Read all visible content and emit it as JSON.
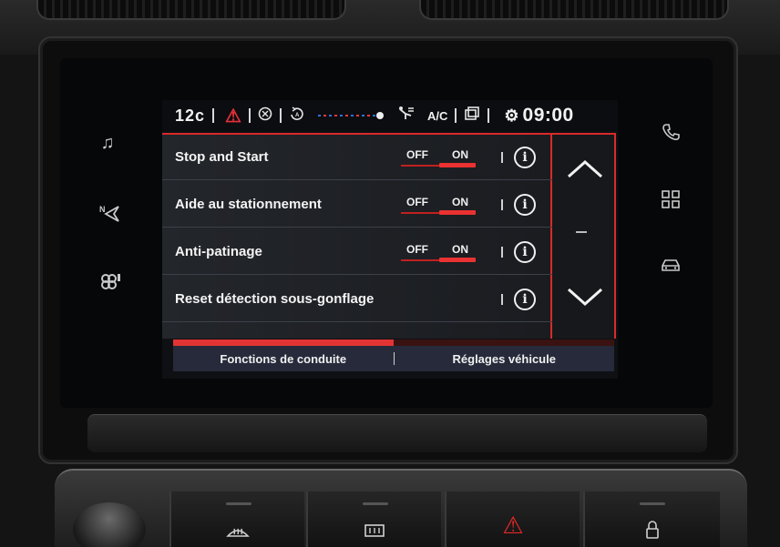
{
  "status_bar": {
    "temperature": "12c",
    "warning_icon": "warning-triangle-icon",
    "ac_label": "A/C",
    "clock": "09:00"
  },
  "settings": {
    "rows": [
      {
        "label": "Stop and Start",
        "off": "OFF",
        "on": "ON",
        "state": "ON",
        "has_toggle": true
      },
      {
        "label": "Aide au stationnement",
        "off": "OFF",
        "on": "ON",
        "state": "ON",
        "has_toggle": true
      },
      {
        "label": "Anti-patinage",
        "off": "OFF",
        "on": "ON",
        "state": "ON",
        "has_toggle": true
      },
      {
        "label": "Reset détection sous-gonflage",
        "has_toggle": false
      }
    ]
  },
  "tabs": [
    {
      "label": "Fonctions de conduite",
      "active": true
    },
    {
      "label": "Réglages véhicule",
      "active": false
    }
  ],
  "tab_progress": 0.5,
  "colors": {
    "accent": "#e33434",
    "tab_bar": "#262a3a",
    "background": "#0f1013"
  },
  "side_keys": {
    "left": [
      "music-note-icon",
      "navigation-icon",
      "connectivity-icon"
    ],
    "right": [
      "phone-icon",
      "apps-grid-icon",
      "car-icon"
    ]
  },
  "hardware_buttons": [
    "front-defrost-icon",
    "rear-defrost-icon",
    "hazard-icon",
    "lock-icon"
  ]
}
